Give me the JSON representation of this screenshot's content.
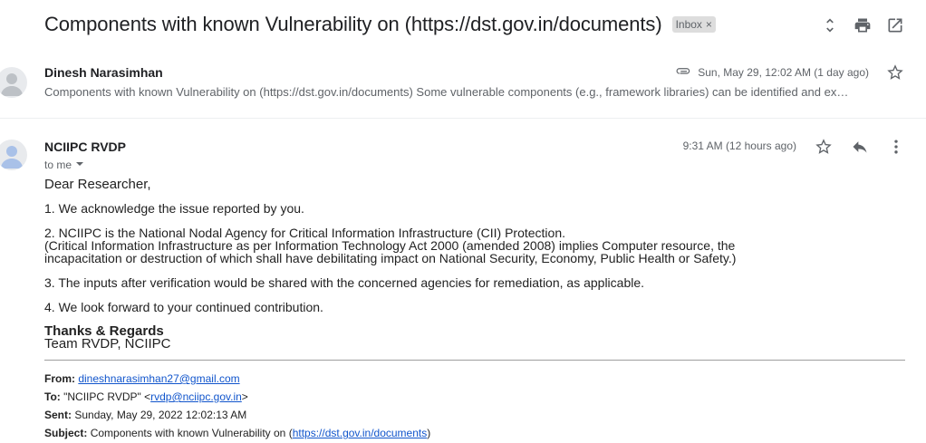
{
  "thread": {
    "subject": "Components with known Vulnerability on (https://dst.gov.in/documents)",
    "label": "Inbox",
    "label_remove": "×"
  },
  "toolbar": {
    "icons": [
      "expand-collapse-icon",
      "print-icon",
      "open-new-window-icon"
    ]
  },
  "message1": {
    "sender": "Dinesh Narasimhan",
    "snippet": "Components with known Vulnerability on (https://dst.gov.in/documents) Some vulnerable components (e.g., framework libraries) can be identified and ex…",
    "date": "Sun, May 29, 12:02 AM (1 day ago)"
  },
  "message2": {
    "sender": "NCIIPC RVDP",
    "to_label": "to me",
    "time": "9:31 AM (12 hours ago)",
    "body": {
      "greeting": "Dear Researcher,",
      "p1": "1. We acknowledge the issue reported by you.",
      "p2_line1": "2. NCIIPC is the National Nodal Agency for Critical Information Infrastructure (CII) Protection.",
      "p2_line2": "(Critical Information Infrastructure as per Information Technology Act 2000 (amended 2008) implies Computer resource, the",
      "p2_line3": "incapacitation or destruction of which shall have debilitating impact on National Security, Economy, Public Health or Safety.)",
      "p3": "3. The inputs after verification would be shared with the concerned agencies for remediation, as applicable.",
      "p4": "4. We look forward to your continued contribution.",
      "closing": "Thanks & Regards",
      "team": "Team RVDP, NCIIPC"
    },
    "quoted": {
      "from_label": "From:",
      "from_email": "dineshnarasimhan27@gmail.com",
      "to_label": "To:",
      "to_name": "\"NCIIPC RVDP\" <",
      "to_email": "rvdp@nciipc.gov.in",
      "to_close": ">",
      "sent_label": "Sent:",
      "sent_value": "Sunday, May 29, 2022 12:02:13 AM",
      "subject_label": "Subject:",
      "subject_prefix": "Components with known Vulnerability on (",
      "subject_link": "https://dst.gov.in/documents",
      "subject_suffix": ")"
    }
  }
}
